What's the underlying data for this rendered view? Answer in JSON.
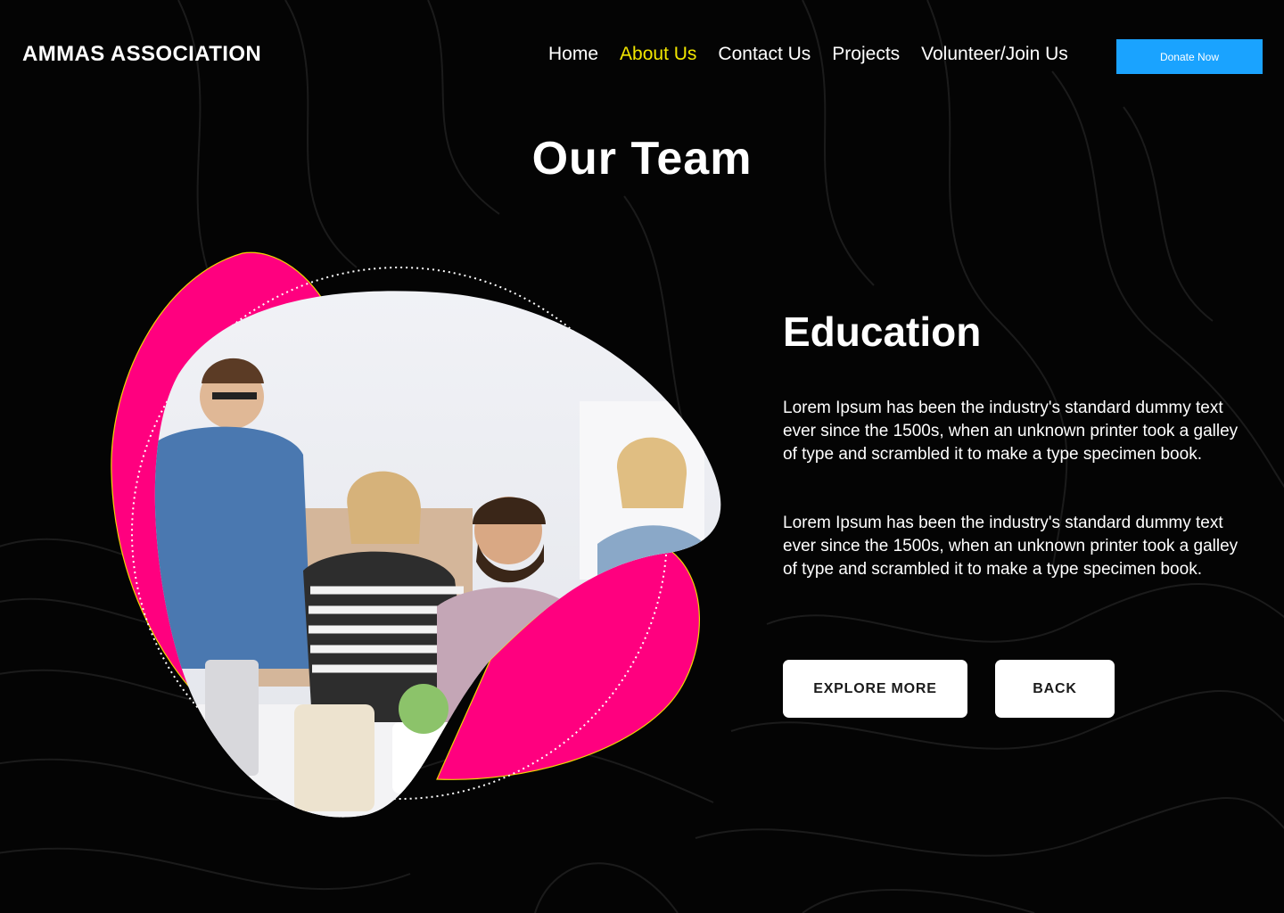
{
  "header": {
    "brand": "AMMAS ASSOCIATION",
    "nav": [
      {
        "label": "Home"
      },
      {
        "label": "About Us"
      },
      {
        "label": "Contact Us"
      },
      {
        "label": "Projects"
      },
      {
        "label": "Volunteer/Join Us"
      }
    ],
    "active_index": 1,
    "donate_label": "Donate Now"
  },
  "main": {
    "title": "Our Team",
    "section_title": "Education",
    "paragraphs": [
      "Lorem Ipsum has been the industry's standard dummy text ever since the 1500s, when an unknown printer took a galley of type and scrambled it to make a type specimen book.",
      "Lorem Ipsum has been the industry's standard dummy text ever since the 1500s, when an unknown printer took a galley of type and scrambled it to make a type specimen book."
    ],
    "buttons": {
      "explore": "EXPLORE MORE",
      "back": "BACK"
    }
  },
  "colors": {
    "background": "#040404",
    "accent_pink": "#ff007f",
    "active_nav": "#f2e600",
    "donate_bg": "#1aa3ff"
  },
  "icons": {
    "hero_photo": "team-photo"
  }
}
